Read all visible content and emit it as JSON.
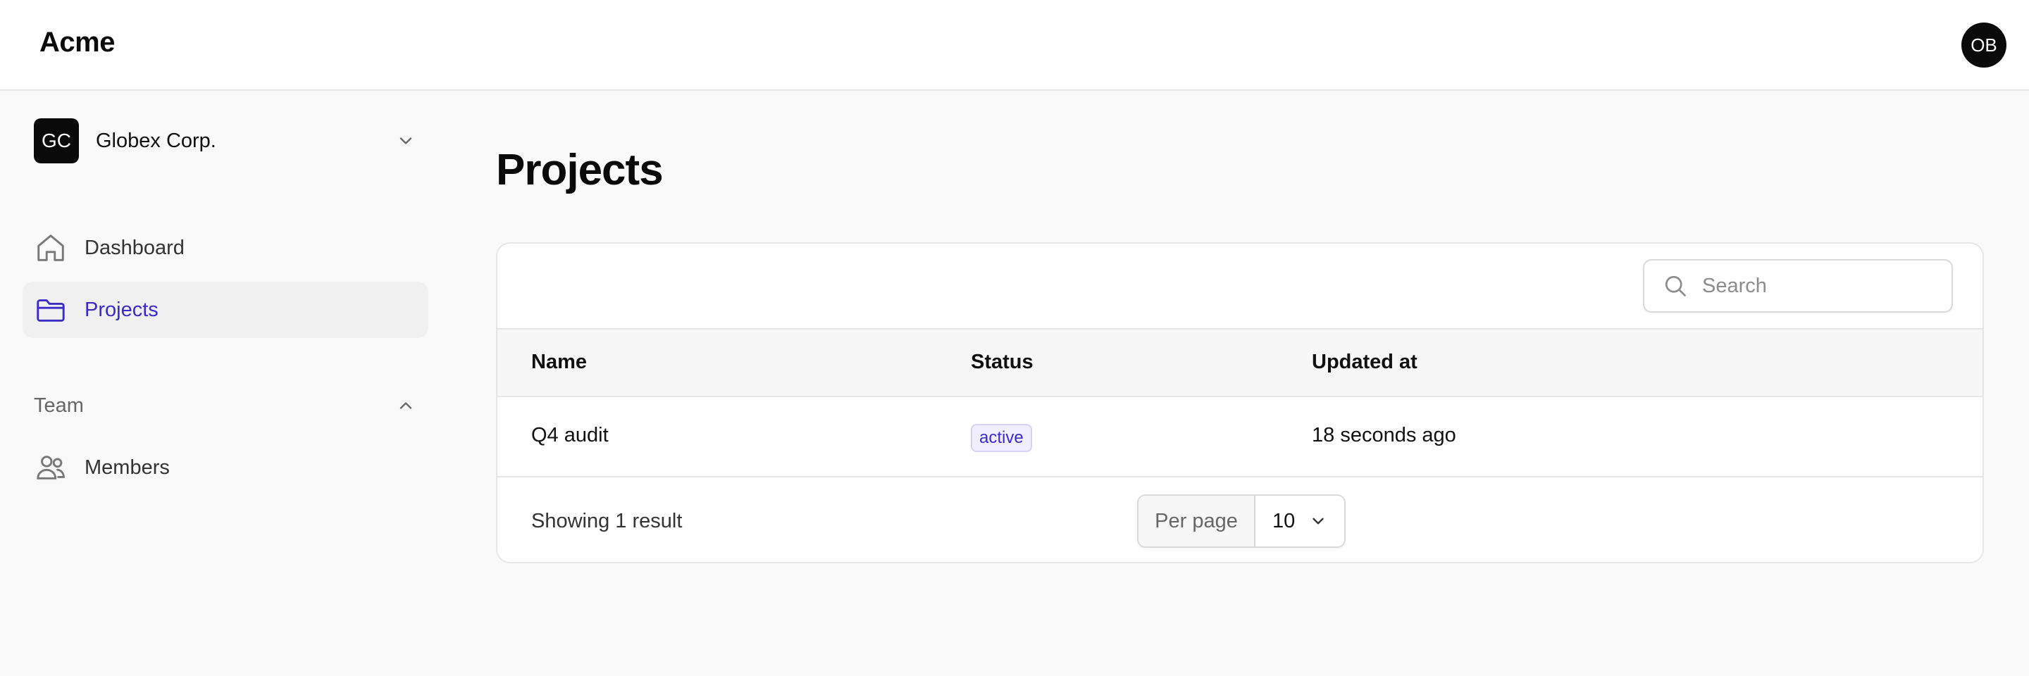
{
  "app": {
    "logo": "Acme",
    "user_initials": "OB"
  },
  "sidebar": {
    "org": {
      "initials": "GC",
      "name": "Globex Corp."
    },
    "items": [
      {
        "label": "Dashboard",
        "icon": "home-icon",
        "active": false
      },
      {
        "label": "Projects",
        "icon": "folder-icon",
        "active": true
      }
    ],
    "team_section": {
      "label": "Team",
      "items": [
        {
          "label": "Members",
          "icon": "users-icon"
        }
      ]
    }
  },
  "main": {
    "title": "Projects",
    "search": {
      "placeholder": "Search",
      "value": ""
    },
    "table": {
      "columns": [
        "Name",
        "Status",
        "Updated at"
      ],
      "rows": [
        {
          "name": "Q4 audit",
          "status": "active",
          "updated": "18 seconds ago"
        }
      ]
    },
    "footer": {
      "result_text": "Showing 1 result",
      "per_page_label": "Per page",
      "per_page_value": "10"
    }
  },
  "colors": {
    "accent": "#3b2bc9",
    "badge_bg": "#f1eefd",
    "avatar_bg": "#0a0a0a"
  }
}
